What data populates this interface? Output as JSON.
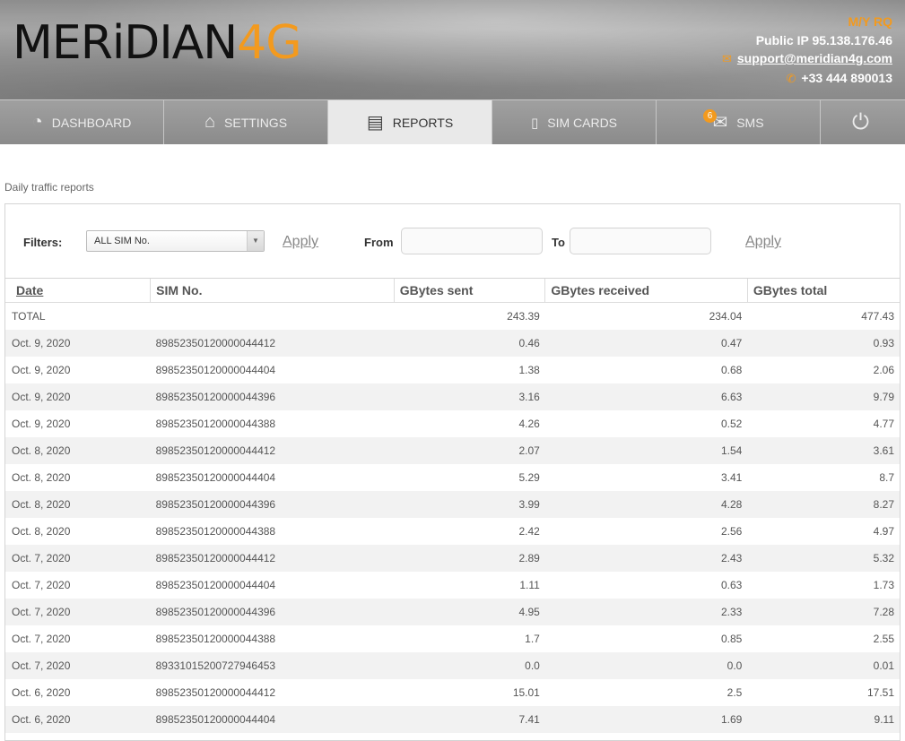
{
  "header": {
    "logo_dark": "MERiDIAN",
    "logo_accent": "4G",
    "company": "M/Y RQ",
    "public_ip": "Public IP 95.138.176.46",
    "email": "support@meridian4g.com",
    "phone": "+33 444 890013"
  },
  "nav": {
    "tabs": [
      {
        "label": "DASHBOARD",
        "icon": "speedometer-icon"
      },
      {
        "label": "SETTINGS",
        "icon": "router-icon"
      },
      {
        "label": "REPORTS",
        "icon": "chart-icon",
        "active": true
      },
      {
        "label": "SIM CARDS",
        "icon": "sim-card-icon"
      },
      {
        "label": "SMS",
        "icon": "envelope-icon",
        "badge": "6"
      },
      {
        "label": "",
        "icon": "power-icon"
      }
    ]
  },
  "page": {
    "title": "Daily traffic reports"
  },
  "filters": {
    "label": "Filters:",
    "sim_select_value": "ALL SIM No.",
    "apply_label": "Apply",
    "from_label": "From",
    "to_label": "To",
    "from_value": "",
    "to_value": "",
    "apply2_label": "Apply"
  },
  "table": {
    "columns": [
      "Date",
      "SIM No.",
      "GBytes sent",
      "GBytes received",
      "GBytes total"
    ],
    "total": {
      "label": "TOTAL",
      "sent": "243.39",
      "received": "234.04",
      "total": "477.43"
    },
    "rows": [
      [
        "Oct. 9, 2020",
        "89852350120000044412",
        "0.46",
        "0.47",
        "0.93"
      ],
      [
        "Oct. 9, 2020",
        "89852350120000044404",
        "1.38",
        "0.68",
        "2.06"
      ],
      [
        "Oct. 9, 2020",
        "89852350120000044396",
        "3.16",
        "6.63",
        "9.79"
      ],
      [
        "Oct. 9, 2020",
        "89852350120000044388",
        "4.26",
        "0.52",
        "4.77"
      ],
      [
        "Oct. 8, 2020",
        "89852350120000044412",
        "2.07",
        "1.54",
        "3.61"
      ],
      [
        "Oct. 8, 2020",
        "89852350120000044404",
        "5.29",
        "3.41",
        "8.7"
      ],
      [
        "Oct. 8, 2020",
        "89852350120000044396",
        "3.99",
        "4.28",
        "8.27"
      ],
      [
        "Oct. 8, 2020",
        "89852350120000044388",
        "2.42",
        "2.56",
        "4.97"
      ],
      [
        "Oct. 7, 2020",
        "89852350120000044412",
        "2.89",
        "2.43",
        "5.32"
      ],
      [
        "Oct. 7, 2020",
        "89852350120000044404",
        "1.11",
        "0.63",
        "1.73"
      ],
      [
        "Oct. 7, 2020",
        "89852350120000044396",
        "4.95",
        "2.33",
        "7.28"
      ],
      [
        "Oct. 7, 2020",
        "89852350120000044388",
        "1.7",
        "0.85",
        "2.55"
      ],
      [
        "Oct. 7, 2020",
        "89331015200727946453",
        "0.0",
        "0.0",
        "0.01"
      ],
      [
        "Oct. 6, 2020",
        "89852350120000044412",
        "15.01",
        "2.5",
        "17.51"
      ],
      [
        "Oct. 6, 2020",
        "89852350120000044404",
        "7.41",
        "1.69",
        "9.11"
      ]
    ]
  },
  "colors": {
    "accent": "#f39a1e",
    "header_bg": "#9a9a9a",
    "active_tab": "#e9e9e9"
  }
}
